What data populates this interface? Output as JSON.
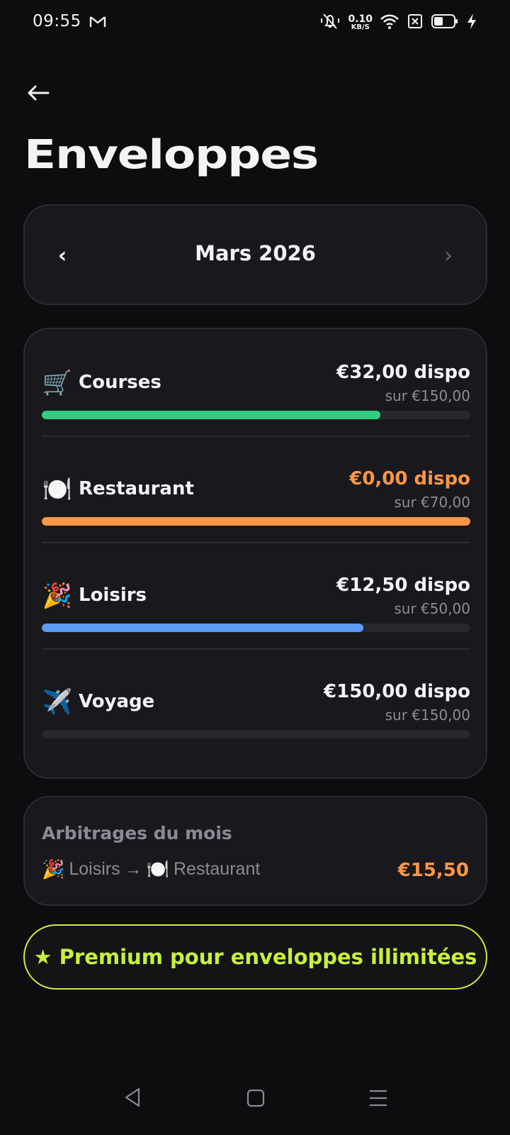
{
  "status_bar": {
    "time": "09:55",
    "speed_value": "0.10",
    "speed_unit": "KB/S",
    "icons": [
      "gmail-icon",
      "mute-icon",
      "wifi-icon",
      "sim-off-icon",
      "battery-icon",
      "charging-icon"
    ]
  },
  "header": {
    "back_icon": "arrow-left-icon",
    "title": "Enveloppes"
  },
  "month_selector": {
    "prev": "‹",
    "label": "Mars 2026",
    "next": "›"
  },
  "envelopes": [
    {
      "emoji": "🛒",
      "name": "Courses",
      "available": "€32,00 dispo",
      "total": "sur €150,00",
      "progress": 0.79,
      "color": "#2ecf85",
      "available_color": "#f4f4f6"
    },
    {
      "emoji": "🍽️",
      "name": "Restaurant",
      "available": "€0,00 dispo",
      "total": "sur €70,00",
      "progress": 1.0,
      "color": "#ff9645",
      "available_color": "#ff9645"
    },
    {
      "emoji": "🎉",
      "name": "Loisirs",
      "available": "€12,50 dispo",
      "total": "sur €50,00",
      "progress": 0.75,
      "color": "#5b9bf5",
      "available_color": "#f4f4f6"
    },
    {
      "emoji": "✈️",
      "name": "Voyage",
      "available": "€150,00 dispo",
      "total": "sur €150,00",
      "progress": 0.0,
      "color": "#5b9bf5",
      "available_color": "#f4f4f6"
    }
  ],
  "arbitrages": {
    "title": "Arbitrages du mois",
    "from_emoji": "🎉",
    "from": "Loisirs",
    "arrow": "→",
    "to_emoji": "🍽️",
    "to": "Restaurant",
    "amount": "€15,50"
  },
  "premium": {
    "label": "★ Premium pour enveloppes illimitées"
  },
  "colors": {
    "background": "#0d0d0f",
    "card": "#19191d",
    "accent": "#c8f03c",
    "warning": "#ff9645"
  }
}
